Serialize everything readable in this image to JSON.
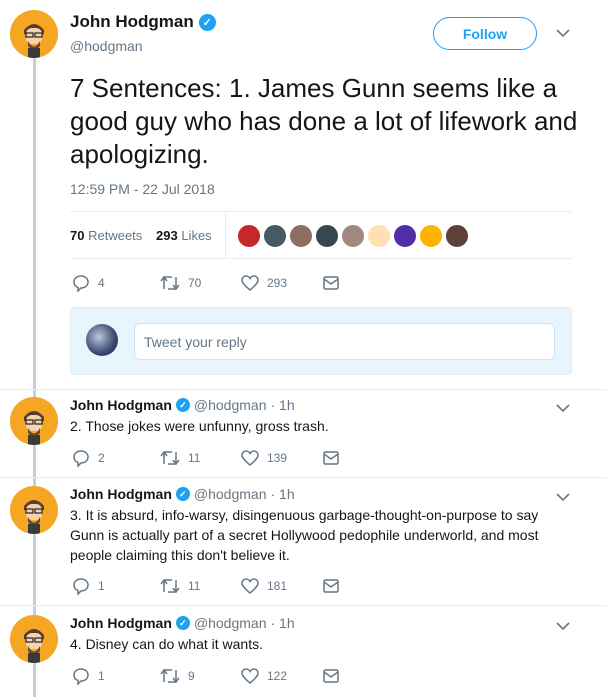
{
  "main_tweet": {
    "author_name": "John Hodgman",
    "author_handle": "@hodgman",
    "follow_label": "Follow",
    "text": "7 Sentences: 1. James Gunn seems like a good guy who has done a lot of lifework and apologizing.",
    "timestamp": "12:59 PM - 22 Jul 2018",
    "retweets_count": "70",
    "retweets_label": "Retweets",
    "likes_count": "293",
    "likes_label": "Likes",
    "actions": {
      "replies": "4",
      "retweets": "70",
      "likes": "293"
    }
  },
  "reply_box": {
    "placeholder": "Tweet your reply"
  },
  "thread": [
    {
      "name": "John Hodgman",
      "handle": "@hodgman",
      "time": "· 1h",
      "text": "2. Those jokes were unfunny, gross trash.",
      "replies": "2",
      "retweets": "11",
      "likes": "139"
    },
    {
      "name": "John Hodgman",
      "handle": "@hodgman",
      "time": "· 1h",
      "text": "3. It is absurd, info-warsy, disingenuous garbage-thought-on-purpose to say Gunn is actually part of a secret Hollywood pedophile underworld, and most people claiming this don't believe it.",
      "replies": "1",
      "retweets": "11",
      "likes": "181"
    },
    {
      "name": "John Hodgman",
      "handle": "@hodgman",
      "time": "· 1h",
      "text": "4. Disney can do what it wants.",
      "replies": "1",
      "retweets": "9",
      "likes": "122"
    }
  ],
  "colors": {
    "accent": "#1da1f2",
    "text": "#14171a",
    "secondary": "#657786",
    "avatar_bg": "#f5a623"
  }
}
